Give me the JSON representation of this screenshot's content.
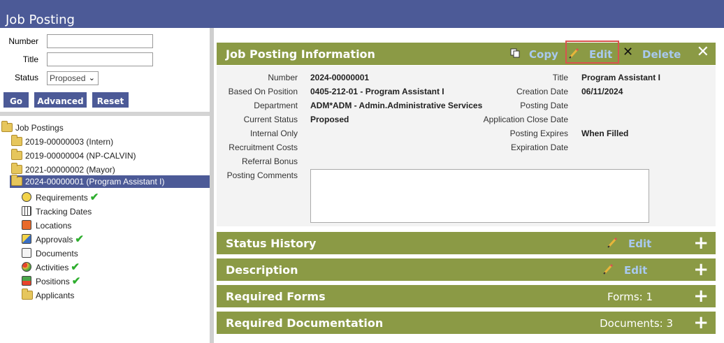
{
  "app": {
    "title": "Job Posting"
  },
  "search": {
    "number_label": "Number",
    "number_value": "",
    "title_label": "Title",
    "title_value": "",
    "status_label": "Status",
    "status_value": "Proposed",
    "go_label": "Go",
    "advanced_label": "Advanced",
    "reset_label": "Reset"
  },
  "tree": {
    "root": "Job Postings",
    "postings": [
      "2019-00000003 (Intern)",
      "2019-00000004 (NP-CALVIN)",
      "2021-00000002 (Mayor)",
      "2024-00000001 (Program Assistant I)"
    ],
    "children": [
      {
        "label": "Requirements",
        "check": true
      },
      {
        "label": "Tracking Dates",
        "check": false
      },
      {
        "label": "Locations",
        "check": false
      },
      {
        "label": "Approvals",
        "check": true
      },
      {
        "label": "Documents",
        "check": false
      },
      {
        "label": "Activities",
        "check": true
      },
      {
        "label": "Positions",
        "check": true
      },
      {
        "label": "Applicants",
        "check": false
      }
    ]
  },
  "info": {
    "header": "Job Posting Information",
    "copy_label": "Copy",
    "edit_label": "Edit",
    "delete_label": "Delete",
    "fields_left": [
      {
        "label": "Number",
        "value": "2024-00000001"
      },
      {
        "label": "Based On Position",
        "value": "0405-212-01 - Program Assistant I"
      },
      {
        "label": "Department",
        "value": "ADM*ADM - Admin.Administrative Services"
      },
      {
        "label": "Current Status",
        "value": "Proposed"
      },
      {
        "label": "Internal Only",
        "value": ""
      },
      {
        "label": "Recruitment Costs",
        "value": ""
      },
      {
        "label": "Referral Bonus",
        "value": ""
      },
      {
        "label": "Posting Comments",
        "value": ""
      }
    ],
    "fields_right": [
      {
        "label": "Title",
        "value": "Program Assistant I"
      },
      {
        "label": "Creation Date",
        "value": "06/11/2024"
      },
      {
        "label": "Posting Date",
        "value": ""
      },
      {
        "label": "Application Close Date",
        "value": ""
      },
      {
        "label": "Posting Expires",
        "value": "When Filled"
      },
      {
        "label": "Expiration Date",
        "value": ""
      }
    ]
  },
  "sections": [
    {
      "title": "Status History",
      "action": "Edit",
      "count": ""
    },
    {
      "title": "Description",
      "action": "Edit",
      "count": ""
    },
    {
      "title": "Required Forms",
      "action": "",
      "count": "Forms: 1"
    },
    {
      "title": "Required Documentation",
      "action": "",
      "count": "Documents: 3"
    }
  ],
  "colors": {
    "header": "#4c5a97",
    "section_bar": "#8b9a45",
    "action_link": "#a8c9ef",
    "selected": "#4c5a97",
    "check": "#2eae2e",
    "highlight": "#d9534f"
  }
}
